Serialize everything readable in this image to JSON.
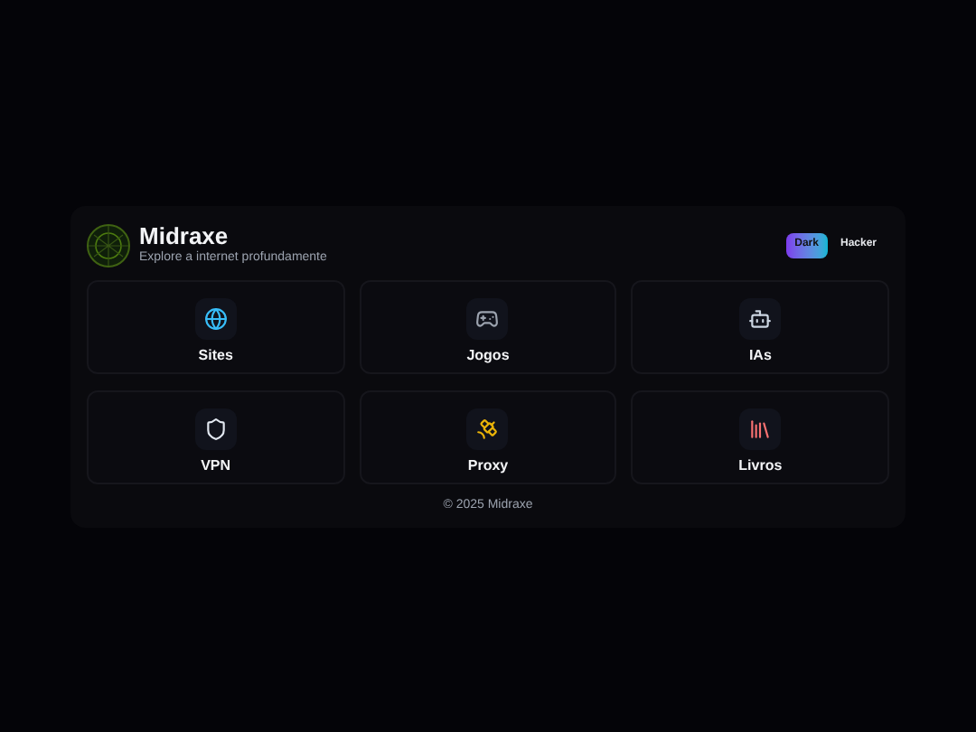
{
  "header": {
    "title": "Midraxe",
    "subtitle": "Explore a internet profundamente"
  },
  "themes": [
    {
      "label": "Dark",
      "selected": true
    },
    {
      "label": "Hacker",
      "selected": false
    }
  ],
  "tiles": [
    {
      "kind": "globe",
      "label": "Sites"
    },
    {
      "kind": "gamepad",
      "label": "Jogos"
    },
    {
      "kind": "robot",
      "label": "IAs"
    },
    {
      "kind": "shield",
      "label": "VPN"
    },
    {
      "kind": "satellite",
      "label": "Proxy"
    },
    {
      "kind": "books",
      "label": "Livros"
    }
  ],
  "footer": "© 2025 Midraxe"
}
